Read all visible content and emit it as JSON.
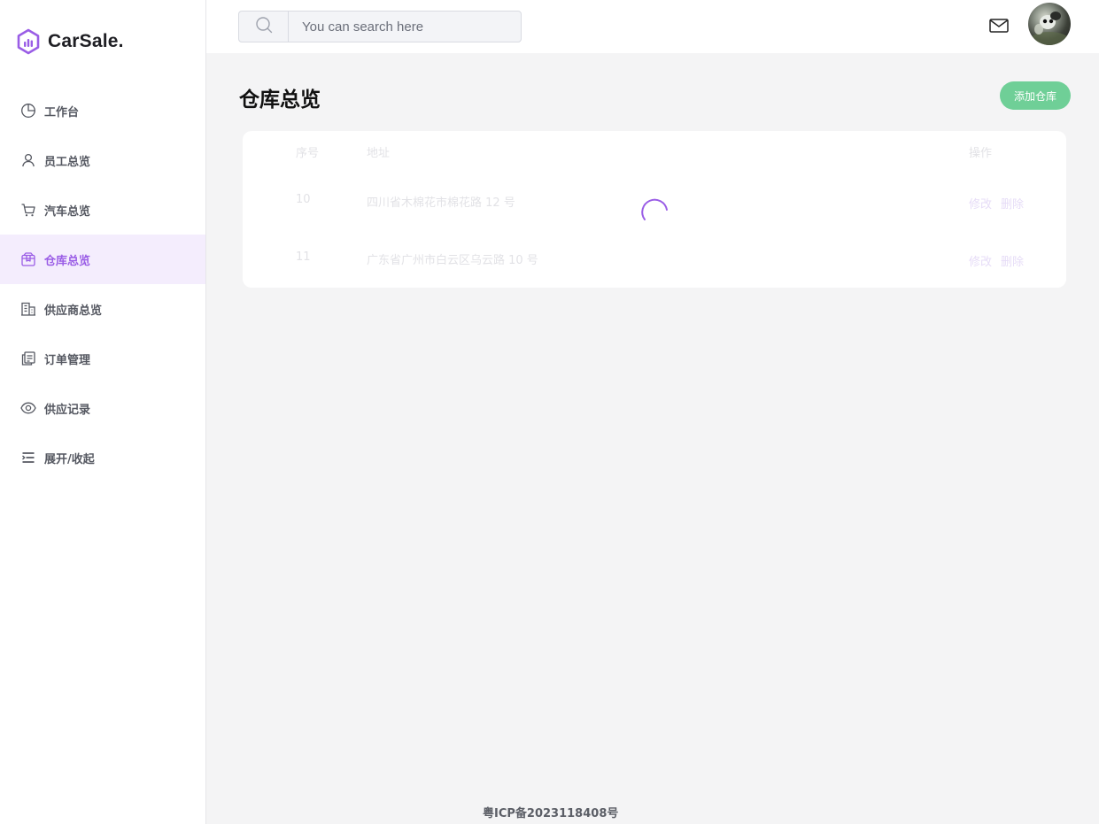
{
  "app": {
    "name": "CarSale.",
    "accent": "#9a5de6",
    "success": "#6fcf97"
  },
  "sidebar": {
    "items": [
      {
        "label": "工作台",
        "icon": "pie-chart-icon",
        "active": false
      },
      {
        "label": "员工总览",
        "icon": "user-icon",
        "active": false
      },
      {
        "label": "汽车总览",
        "icon": "cart-icon",
        "active": false
      },
      {
        "label": "仓库总览",
        "icon": "box-icon",
        "active": true
      },
      {
        "label": "供应商总览",
        "icon": "building-icon",
        "active": false
      },
      {
        "label": "订单管理",
        "icon": "document-icon",
        "active": false
      },
      {
        "label": "供应记录",
        "icon": "eye-icon",
        "active": false
      },
      {
        "label": "展开/收起",
        "icon": "collapse-icon",
        "active": false
      }
    ]
  },
  "header": {
    "search_placeholder": "You can search here",
    "icons": [
      "search-icon",
      "mail-icon",
      "avatar"
    ]
  },
  "main": {
    "title": "仓库总览",
    "add_button": "添加仓库",
    "table": {
      "columns": [
        "序号",
        "地址",
        "操作"
      ],
      "rows": [
        {
          "id": "10",
          "address": "四川省木棉花市棉花路 12 号",
          "edit": "修改",
          "delete": "删除"
        },
        {
          "id": "11",
          "address": "广东省广州市白云区乌云路 10 号",
          "edit": "修改",
          "delete": "删除"
        }
      ],
      "loading": true
    }
  },
  "footer": {
    "icp": "粤ICP备2023118408号"
  }
}
